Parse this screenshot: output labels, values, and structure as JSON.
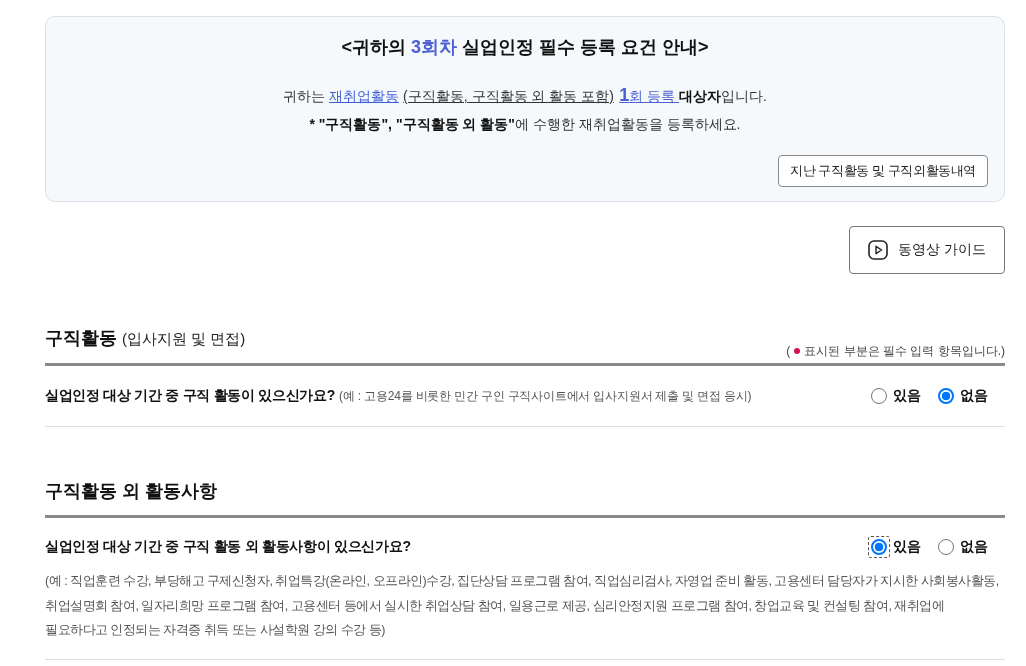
{
  "notice": {
    "title": [
      {
        "text": "<귀하의 ",
        "highlight": false
      },
      {
        "text": "3회차",
        "highlight": true
      },
      {
        "text": " 실업인정 필수 등록 요건 안내>",
        "highlight": false
      }
    ],
    "message": [
      {
        "kind": "text",
        "text": "귀하는 "
      },
      {
        "kind": "link",
        "text": "재취업활동"
      },
      {
        "kind": "underline",
        "text": "(구직활동, 구직활동 외 활동 포함)"
      },
      {
        "kind": "highlight_big",
        "text": "1"
      },
      {
        "kind": "highlight",
        "text": "회 등록 "
      },
      {
        "kind": "bold",
        "text": "대상자"
      },
      {
        "kind": "text",
        "text": "입니다."
      }
    ],
    "instruction": [
      {
        "kind": "bold",
        "text": "* \"구직활동\", \"구직활동 외 활동\""
      },
      {
        "kind": "text",
        "text": "에 수행한 재취업활동을 등록하세요."
      }
    ],
    "history_button": "지난 구직활동 및 구직외활동내역"
  },
  "video_guide_button": "동영상 가이드",
  "sections": [
    {
      "title": "구직활동",
      "subtitle": "(입사지원 및 면접)",
      "required_note": {
        "open": "(",
        "text": "표시된 부분은 필수 입력 항목입니다.)"
      },
      "question": {
        "label": "실업인정 대상 기간 중 구직 활동이 있으신가요?",
        "hint": "(예 : 고용24를 비롯한 민간 구인 구직사이트에서 입사지원서 제출 및 면접 응시)",
        "options": [
          {
            "label": "있음",
            "selected": false,
            "focused": false
          },
          {
            "label": "없음",
            "selected": true,
            "focused": false
          }
        ]
      }
    },
    {
      "title": "구직활동 외 활동사항",
      "question": {
        "label": "실업인정 대상 기간 중 구직 활동 외 활동사항이 있으신가요?",
        "description": "(예 : 직업훈련 수강, 부당해고 구제신청자, 취업특강(온라인, 오프라인)수강, 집단상담 프로그램 참여, 직업심리검사, 자영업 준비 활동, 고용센터 담당자가 지시한 사회봉사활동, 취업설명회 참여, 일자리희망 프로그램 참여, 고용센터 등에서 실시한 취업상담 참여, 일용근로 제공, 심리안정지원 프로그램 참여, 창업교육 및 컨설팅 참여, 재취업에 필요하다고 인정되는 자격증 취득 또는 사설학원 강의 수강 등)",
        "options": [
          {
            "label": "있음",
            "selected": true,
            "focused": true
          },
          {
            "label": "없음",
            "selected": false,
            "focused": false
          }
        ]
      }
    }
  ]
}
